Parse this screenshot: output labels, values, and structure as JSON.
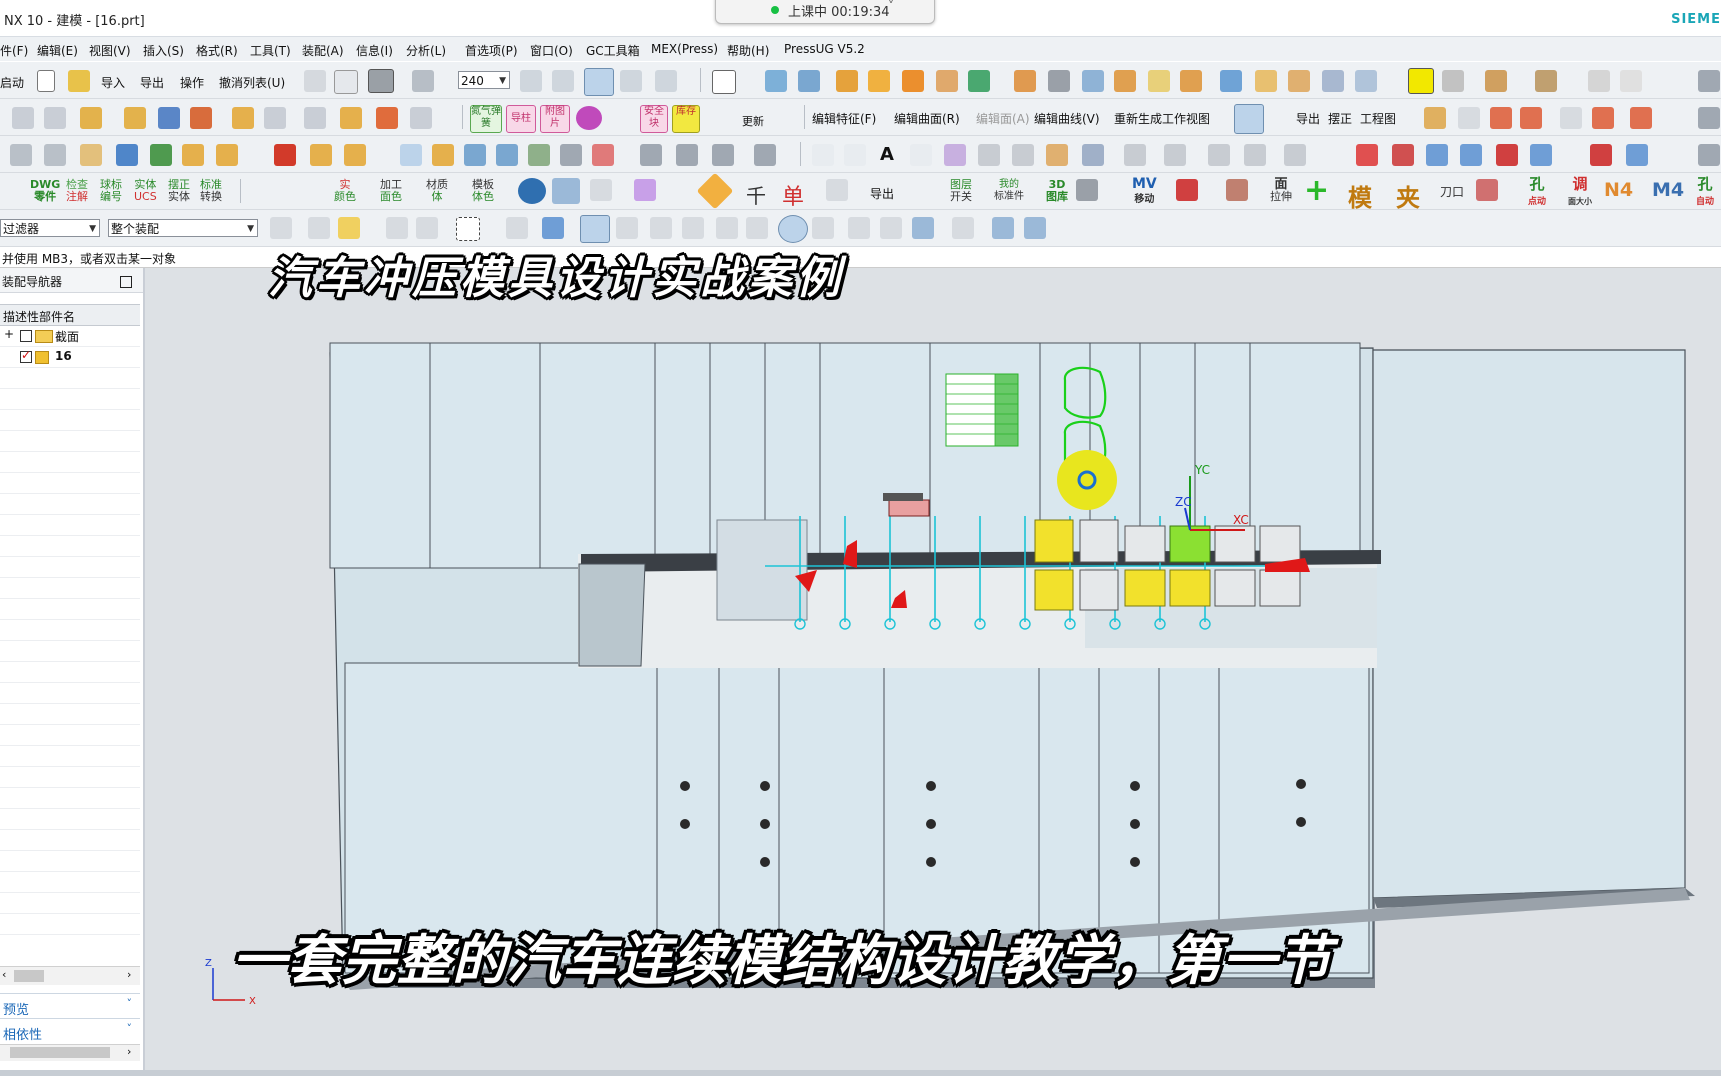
{
  "window": {
    "title": "NX 10 - 建模 - [16.prt]",
    "brand": "SIEME",
    "recording": {
      "label": "上课中 00:19:34",
      "chevron": "˅"
    }
  },
  "menubar": [
    "件(F)",
    "编辑(E)",
    "视图(V)",
    "插入(S)",
    "格式(R)",
    "工具(T)",
    "装配(A)",
    "信息(I)",
    "分析(L)",
    "首选项(P)",
    "窗口(O)",
    "GC工具箱",
    "MEX(Press)",
    "帮助(H)",
    "PressUG V5.2"
  ],
  "toolbar_row1": {
    "start": "启动",
    "import": "导入",
    "export": "导出",
    "operate": "操作",
    "undo_list": "撤消列表(U)",
    "zoom_value": "240"
  },
  "toolbar_row2": {
    "update": "更新",
    "edit_feature": "编辑特征(F)",
    "edit_surface": "编辑曲面(R)",
    "edit_section": "编辑面(A)",
    "edit_curve": "编辑曲线(V)",
    "regen": "重新生成工作视图",
    "export": "导出",
    "correct": "摆正",
    "drawing": "工程图",
    "btn_gas": "氮气弹簧",
    "btn_guide": "导柱",
    "btn_attach": "附图片",
    "btn_safe": "安全块",
    "btn_store": "库存"
  },
  "toolbar_row4": {
    "dwg": [
      "DWG",
      "零件"
    ],
    "check": [
      "检查",
      "注解"
    ],
    "ball": [
      "球标",
      "编号"
    ],
    "solid": [
      "实体",
      "UCS"
    ],
    "place": [
      "摆正",
      "实体"
    ],
    "standard": [
      "标准",
      "转换"
    ],
    "real": [
      "实",
      "颜色"
    ],
    "machining": [
      "加工",
      "面色"
    ],
    "material": [
      "材质",
      "体"
    ],
    "template": [
      "模板",
      "体色"
    ],
    "thousand": "千",
    "single": "单",
    "export": "导出",
    "layer": [
      "图层",
      "开关"
    ],
    "mine": [
      "我的",
      "标准件"
    ],
    "lib3d": [
      "3D",
      "图库"
    ],
    "mv": [
      "MV",
      "移动"
    ],
    "face": [
      "面",
      "拉伸"
    ],
    "mold": "模",
    "clip": "夹",
    "blade": "刀口",
    "hole": [
      "孔",
      "点动"
    ],
    "adjust": [
      "调",
      "面大小"
    ],
    "n4": "N4",
    "m4": "M4",
    "auto": [
      "孔",
      "自动"
    ]
  },
  "selection_bar": {
    "filter": "过滤器",
    "scope": "整个装配"
  },
  "status": "并使用 MB3，或者双击某一对象",
  "navigator": {
    "title": "装配导航器",
    "column": "描述性部件名",
    "rows": [
      {
        "expander": "+",
        "checked": false,
        "label": "截面"
      },
      {
        "expander": "",
        "checked": true,
        "label": "16"
      }
    ],
    "panels": [
      "预览",
      "相依性"
    ],
    "chevron": "˅"
  },
  "viewport": {
    "background": "#dde1e5",
    "plate_color": "#d5e3ea",
    "axis": {
      "yc": "YC",
      "zc": "ZC",
      "xc": "XC"
    },
    "triad": {
      "z": "Z",
      "x": "X"
    }
  },
  "captions": {
    "top": "汽车冲压模具设计实战案例",
    "bottom": "一套完整的汽车连续模结构设计教学，第一节"
  },
  "colors": {
    "brand": "#1aa6b7",
    "rec_dot": "#17c043",
    "panel_link": "#1a67b7"
  }
}
